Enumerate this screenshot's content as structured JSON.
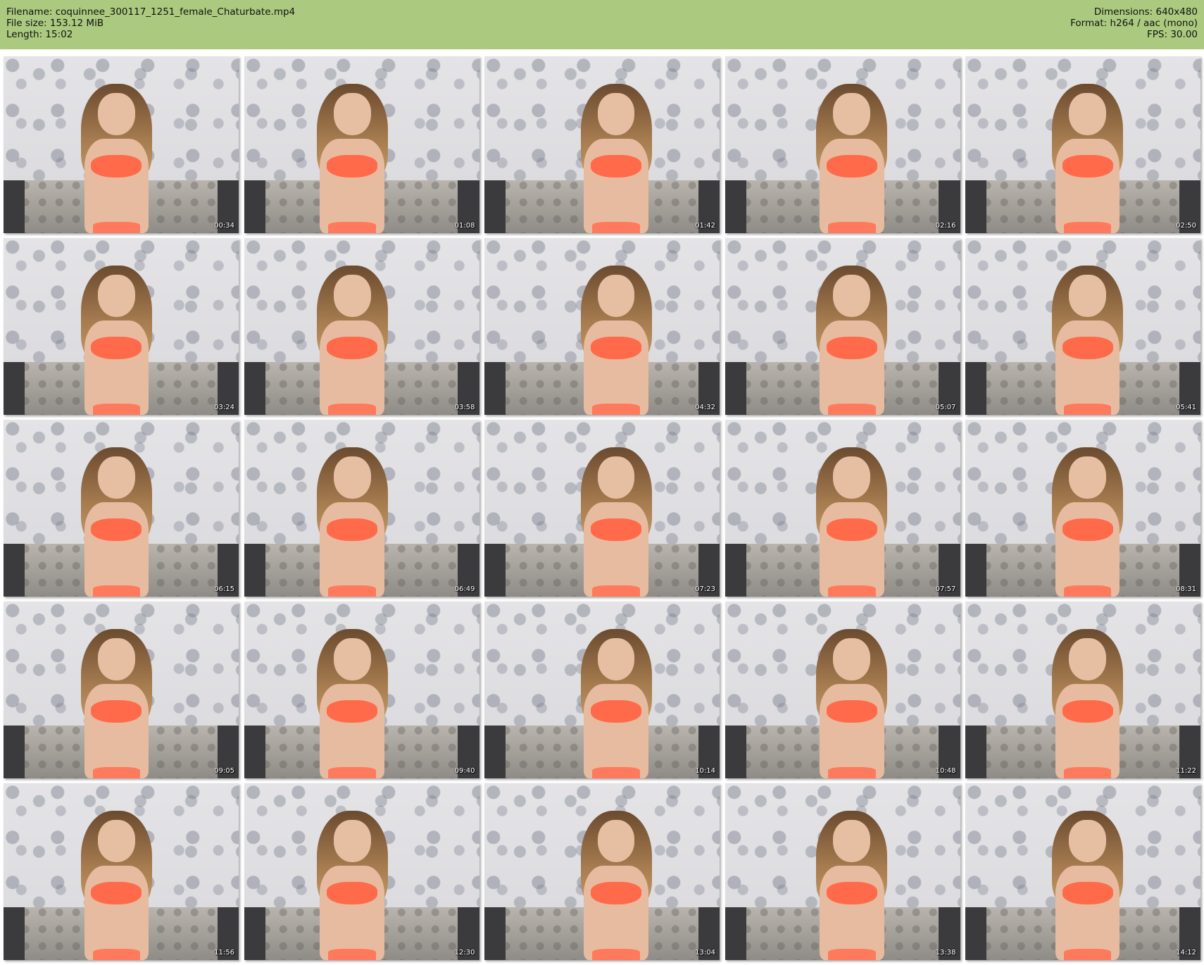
{
  "header": {
    "filename": "Filename: coquinnee_300117_1251_female_Chaturbate.mp4",
    "filesize": "File size: 153.12 MiB",
    "length": "Length: 15:02",
    "dimensions": "Dimensions: 640x480",
    "format": "Format: h264 / aac (mono)",
    "fps": "FPS: 30.00"
  },
  "colors": {
    "header_bg": "#abca7f",
    "bra": "#ff6a4a",
    "wall": "#e4e3e6"
  },
  "thumbnails": [
    {
      "timestamp": "00:34"
    },
    {
      "timestamp": "01:08"
    },
    {
      "timestamp": "01:42"
    },
    {
      "timestamp": "02:16"
    },
    {
      "timestamp": "02:50"
    },
    {
      "timestamp": "03:24"
    },
    {
      "timestamp": "03:58"
    },
    {
      "timestamp": "04:32"
    },
    {
      "timestamp": "05:07"
    },
    {
      "timestamp": "05:41"
    },
    {
      "timestamp": "06:15"
    },
    {
      "timestamp": "06:49"
    },
    {
      "timestamp": "07:23"
    },
    {
      "timestamp": "07:57"
    },
    {
      "timestamp": "08:31"
    },
    {
      "timestamp": "09:05"
    },
    {
      "timestamp": "09:40"
    },
    {
      "timestamp": "10:14"
    },
    {
      "timestamp": "10:48"
    },
    {
      "timestamp": "11:22"
    },
    {
      "timestamp": "11:56"
    },
    {
      "timestamp": "12:30"
    },
    {
      "timestamp": "13:04"
    },
    {
      "timestamp": "13:38"
    },
    {
      "timestamp": "14:12"
    }
  ]
}
